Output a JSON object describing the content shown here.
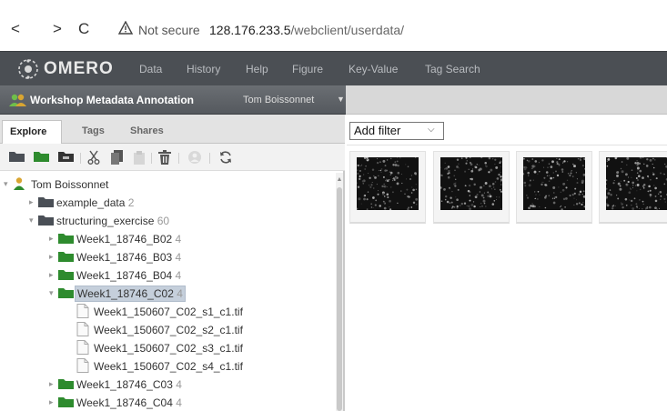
{
  "browser": {
    "back": "<",
    "forward": ">",
    "reload": "C",
    "security_label": "Not secure",
    "url_host": "128.176.233.5",
    "url_path": "/webclient/userdata/"
  },
  "app": {
    "logo_text": "OMERO",
    "nav": [
      "Data",
      "History",
      "Help",
      "Figure",
      "Key-Value",
      "Tag Search"
    ]
  },
  "group_bar": {
    "group_name": "Workshop Metadata Annotation",
    "user_name": "Tom Boissonnet"
  },
  "tabs": [
    "Explore",
    "Tags",
    "Shares"
  ],
  "tree": {
    "root": "Tom Boissonnet",
    "nodes": [
      {
        "label": "example_data",
        "count": "2"
      },
      {
        "label": "structuring_exercise",
        "count": "60"
      },
      {
        "label": "Week1_18746_B02",
        "count": "4"
      },
      {
        "label": "Week1_18746_B03",
        "count": "4"
      },
      {
        "label": "Week1_18746_B04",
        "count": "4"
      },
      {
        "label": "Week1_18746_C02",
        "count": "4"
      },
      {
        "label": "Week1_150607_C02_s1_c1.tif",
        "count": ""
      },
      {
        "label": "Week1_150607_C02_s2_c1.tif",
        "count": ""
      },
      {
        "label": "Week1_150607_C02_s3_c1.tif",
        "count": ""
      },
      {
        "label": "Week1_150607_C02_s4_c1.tif",
        "count": ""
      },
      {
        "label": "Week1_18746_C03",
        "count": "4"
      },
      {
        "label": "Week1_18746_C04",
        "count": "4"
      }
    ]
  },
  "center": {
    "filter_label": "Add filter"
  },
  "colors": {
    "topbar": "#4b4f54",
    "folder": "#4a4f56",
    "folder_green": "#2e8b2e",
    "selection": "#c5cfdb"
  }
}
